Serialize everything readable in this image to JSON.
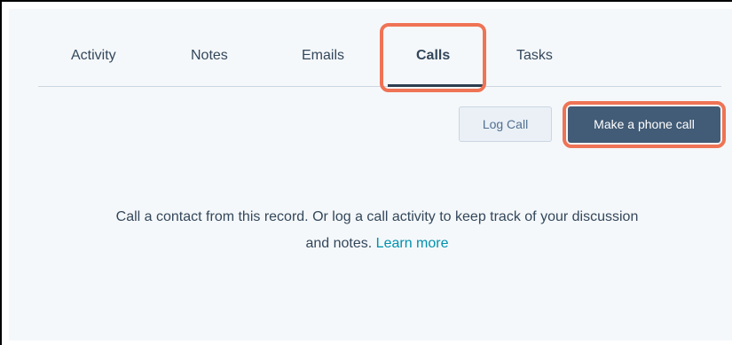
{
  "tabs": [
    {
      "label": "Activity"
    },
    {
      "label": "Notes"
    },
    {
      "label": "Emails"
    },
    {
      "label": "Calls"
    },
    {
      "label": "Tasks"
    }
  ],
  "active_tab": "Calls",
  "actions": {
    "log_call_label": "Log Call",
    "make_call_label": "Make a phone call"
  },
  "empty_state": {
    "line1": "Call a contact from this record. Or log a call activity to keep track of your discussion",
    "line2": "and notes.",
    "link_label": "Learn more"
  },
  "colors": {
    "highlight": "#ef7355",
    "primary_button": "#425b76",
    "link": "#0091ae",
    "text": "#33475b"
  }
}
